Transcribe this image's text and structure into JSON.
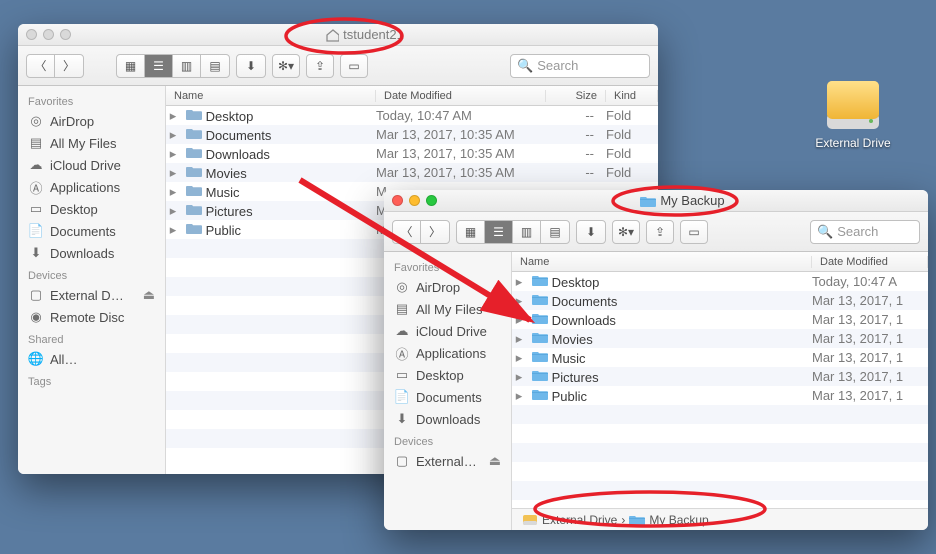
{
  "desktop": {
    "external_drive_label": "External Drive"
  },
  "windowA": {
    "title": "tstudent21",
    "search_placeholder": "Search",
    "cols": {
      "name": "Name",
      "date": "Date Modified",
      "size": "Size",
      "kind": "Kind"
    },
    "sidebar": {
      "favorites_header": "Favorites",
      "items": [
        {
          "label": "AirDrop"
        },
        {
          "label": "All My Files"
        },
        {
          "label": "iCloud Drive"
        },
        {
          "label": "Applications"
        },
        {
          "label": "Desktop"
        },
        {
          "label": "Documents"
        },
        {
          "label": "Downloads"
        }
      ],
      "devices_header": "Devices",
      "devices": [
        {
          "label": "External D…"
        },
        {
          "label": "Remote Disc"
        }
      ],
      "shared_header": "Shared",
      "shared": [
        {
          "label": "All…"
        }
      ],
      "tags_header": "Tags"
    },
    "rows": [
      {
        "name": "Desktop",
        "date": "Today, 10:47 AM",
        "size": "--",
        "kind": "Fold"
      },
      {
        "name": "Documents",
        "date": "Mar 13, 2017, 10:35 AM",
        "size": "--",
        "kind": "Fold"
      },
      {
        "name": "Downloads",
        "date": "Mar 13, 2017, 10:35 AM",
        "size": "--",
        "kind": "Fold"
      },
      {
        "name": "Movies",
        "date": "Mar 13, 2017, 10:35 AM",
        "size": "--",
        "kind": "Fold"
      },
      {
        "name": "Music",
        "date": "M",
        "size": "",
        "kind": ""
      },
      {
        "name": "Pictures",
        "date": "M",
        "size": "",
        "kind": ""
      },
      {
        "name": "Public",
        "date": "M",
        "size": "",
        "kind": ""
      }
    ]
  },
  "windowB": {
    "title": "My Backup",
    "search_placeholder": "Search",
    "cols": {
      "name": "Name",
      "date": "Date Modified"
    },
    "sidebar": {
      "favorites_header": "Favorites",
      "items": [
        {
          "label": "AirDrop"
        },
        {
          "label": "All My Files"
        },
        {
          "label": "iCloud Drive"
        },
        {
          "label": "Applications"
        },
        {
          "label": "Desktop"
        },
        {
          "label": "Documents"
        },
        {
          "label": "Downloads"
        }
      ],
      "devices_header": "Devices",
      "devices": [
        {
          "label": "External…"
        }
      ]
    },
    "rows": [
      {
        "name": "Desktop",
        "date": "Today, 10:47 A"
      },
      {
        "name": "Documents",
        "date": "Mar 13, 2017, 1"
      },
      {
        "name": "Downloads",
        "date": "Mar 13, 2017, 1"
      },
      {
        "name": "Movies",
        "date": "Mar 13, 2017, 1"
      },
      {
        "name": "Music",
        "date": "Mar 13, 2017, 1"
      },
      {
        "name": "Pictures",
        "date": "Mar 13, 2017, 1"
      },
      {
        "name": "Public",
        "date": "Mar 13, 2017, 1"
      }
    ],
    "path": {
      "seg1": "External Drive",
      "seg2": "My Backup"
    }
  }
}
